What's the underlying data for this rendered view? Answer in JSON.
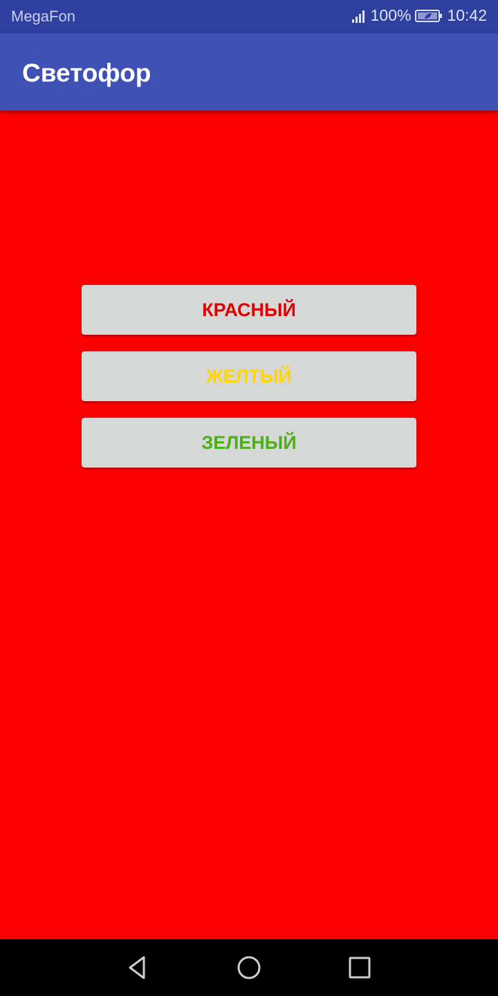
{
  "status_bar": {
    "carrier": "MegaFon",
    "battery_percent": "100%",
    "time": "10:42",
    "icons": [
      "signal-icon",
      "battery-icon"
    ]
  },
  "app_bar": {
    "title": "Светофор",
    "color": "#3f51b5"
  },
  "content": {
    "background_color": "#ff0000",
    "buttons": [
      {
        "label": "КРАСНЫЙ",
        "text_color": "#e00000"
      },
      {
        "label": "ЖЕЛТЫЙ",
        "text_color": "#ffd700"
      },
      {
        "label": "ЗЕЛЕНЫЙ",
        "text_color": "#4caf1a"
      }
    ]
  },
  "nav_bar": {
    "icons": [
      "back-icon",
      "home-icon",
      "recents-icon"
    ]
  }
}
